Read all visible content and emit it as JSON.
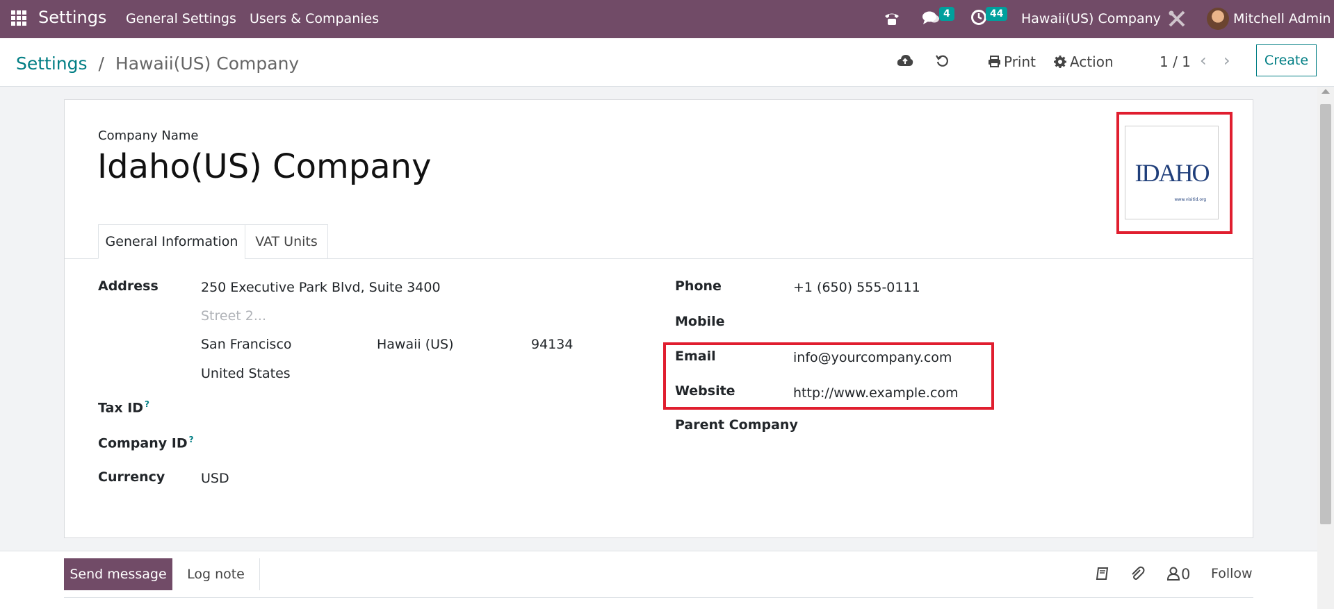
{
  "topbar": {
    "app_title": "Settings",
    "menu": [
      "General Settings",
      "Users & Companies"
    ],
    "messages_badge": "4",
    "activities_badge": "44",
    "company": "Hawaii(US) Company",
    "user": "Mitchell Admin",
    "icons": [
      "apps-icon",
      "phone-icon",
      "chat-icon",
      "clock-icon",
      "debug-tools-icon",
      "avatar"
    ]
  },
  "control_panel": {
    "breadcrumb_root": "Settings",
    "breadcrumb_sep": "/",
    "breadcrumb_current": "Hawaii(US) Company",
    "print_label": "Print",
    "action_label": "Action",
    "pager": "1 / 1",
    "create_label": "Create"
  },
  "form": {
    "company_name_label": "Company Name",
    "company_name": "Idaho(US) Company",
    "logo_text": "IDAHO",
    "logo_subtext": "www.visitid.org",
    "tabs": [
      "General Information",
      "VAT Units"
    ],
    "left": {
      "address_label": "Address",
      "street": "250 Executive Park Blvd, Suite 3400",
      "street2_placeholder": "Street 2...",
      "city": "San Francisco",
      "state": "Hawaii (US)",
      "zip": "94134",
      "country": "United States",
      "tax_id_label": "Tax ID",
      "company_id_label": "Company ID",
      "help_mark": "?",
      "currency_label": "Currency",
      "currency": "USD"
    },
    "right": {
      "phone_label": "Phone",
      "phone": "+1 (650) 555-0111",
      "mobile_label": "Mobile",
      "email_label": "Email",
      "email": "info@yourcompany.com",
      "website_label": "Website",
      "website": "http://www.example.com",
      "parent_label": "Parent Company"
    }
  },
  "chatter": {
    "send_label": "Send message",
    "log_label": "Log note",
    "followers_count": "0",
    "follow_label": "Follow"
  },
  "colors": {
    "brand": "#714b67",
    "accent": "#017e84",
    "badge": "#00a09d",
    "highlight": "#e01e2f"
  }
}
